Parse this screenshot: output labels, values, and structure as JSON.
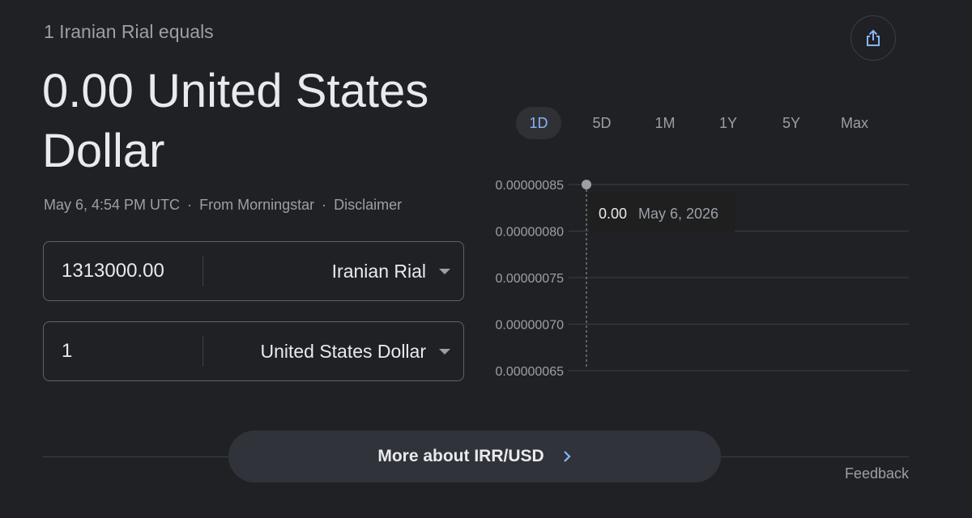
{
  "header": {
    "subtitle": "1 Iranian Rial equals",
    "result_line1": "0.00 United States",
    "result_line2": "Dollar"
  },
  "meta": {
    "timestamp": "May 6, 4:54 PM UTC",
    "separator": "·",
    "source": "From Morningstar",
    "disclaimer": "Disclaimer"
  },
  "share": {
    "icon": "share-icon"
  },
  "converter": {
    "from": {
      "amount": "1313000.00",
      "currency": "Iranian Rial"
    },
    "to": {
      "amount": "1",
      "currency": "United States Dollar"
    }
  },
  "ranges": {
    "tabs": [
      "1D",
      "5D",
      "1M",
      "1Y",
      "5Y",
      "Max"
    ],
    "selected": "1D"
  },
  "chart_data": {
    "type": "line",
    "y_ticks": [
      "0.00000085",
      "0.00000080",
      "0.00000075",
      "0.00000070",
      "0.00000065"
    ],
    "ylim": [
      6.5e-07,
      8.5e-07
    ],
    "points": [
      {
        "x": "May 6, 2026",
        "y": 8.5e-07
      }
    ],
    "grid": true,
    "tooltip": {
      "value": "0.00",
      "date": "May 6, 2026"
    },
    "accent": "#9aa0a6",
    "grid_color": "#3c4043"
  },
  "cta": {
    "label": "More about IRR/USD",
    "icon": "chevron-right-icon",
    "icon_color": "#8ab4f8"
  },
  "footer": {
    "feedback": "Feedback"
  }
}
